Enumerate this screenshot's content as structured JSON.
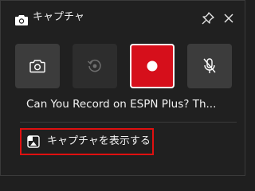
{
  "window": {
    "title": "キャプチャ",
    "icon": "camera-icon"
  },
  "title_actions": {
    "pin_icon": "pin-icon",
    "close_icon": "close-icon"
  },
  "capture_buttons": [
    {
      "name": "screenshot",
      "icon": "camera-icon"
    },
    {
      "name": "record-last",
      "icon": "replay-icon"
    },
    {
      "name": "start-recording",
      "icon": "record-dot-icon"
    },
    {
      "name": "mic",
      "icon": "mic-off-icon"
    }
  ],
  "app_caption": "Can You Record on ESPN Plus? Th...",
  "show_captures": {
    "label": "キャプチャを表示する",
    "icon": "gallery-icon"
  },
  "colors": {
    "background": "#202020",
    "record": "#d60f1b",
    "highlight_border": "#e01010"
  }
}
